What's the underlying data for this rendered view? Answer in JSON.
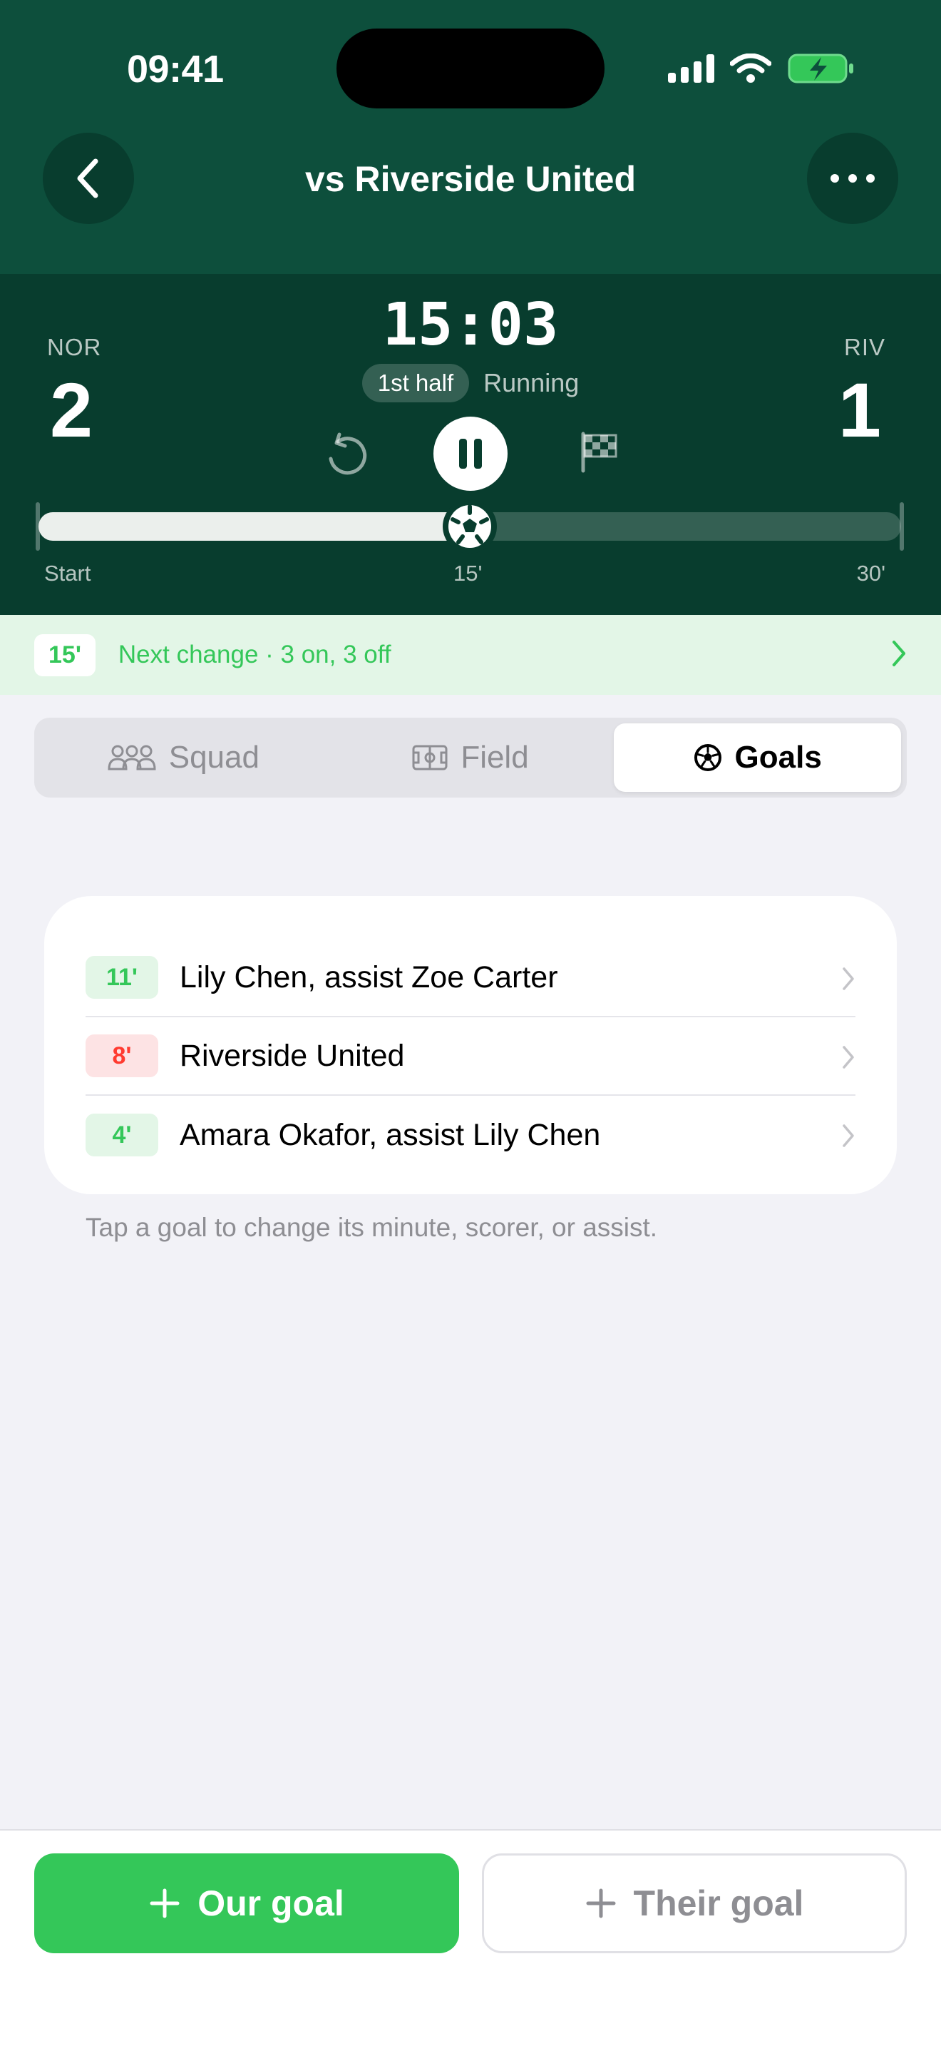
{
  "status_bar": {
    "time": "09:41"
  },
  "header": {
    "title": "vs Riverside United"
  },
  "scoreboard": {
    "home": {
      "code": "NOR",
      "score": "2"
    },
    "away": {
      "code": "RIV",
      "score": "1"
    },
    "clock": "15:03",
    "half": "1st half",
    "state": "Running",
    "progress_fraction": 0.5,
    "timeline_labels": {
      "start": "Start",
      "mid": "15'",
      "end": "30'"
    }
  },
  "next_change": {
    "minute": "15'",
    "text": "Next change · 3 on, 3 off"
  },
  "segments": [
    {
      "label": "Squad",
      "icon": "people-icon",
      "active": false
    },
    {
      "label": "Field",
      "icon": "field-icon",
      "active": false
    },
    {
      "label": "Goals",
      "icon": "soccer-ball-icon",
      "active": true
    }
  ],
  "goals": [
    {
      "minute": "11'",
      "team": "ours",
      "text": "Lily Chen, assist Zoe Carter"
    },
    {
      "minute": "8'",
      "team": "theirs",
      "text": "Riverside United"
    },
    {
      "minute": "4'",
      "team": "ours",
      "text": "Amara Okafor, assist Lily Chen"
    }
  ],
  "hint": "Tap a goal to change its minute, scorer, or assist.",
  "actions": {
    "our_goal": "Our goal",
    "their_goal": "Their goal"
  },
  "colors": {
    "header": "#0d4f3c",
    "scoreboard": "#083d2e",
    "accent_green": "#34c759",
    "accent_red": "#ff3b30"
  }
}
